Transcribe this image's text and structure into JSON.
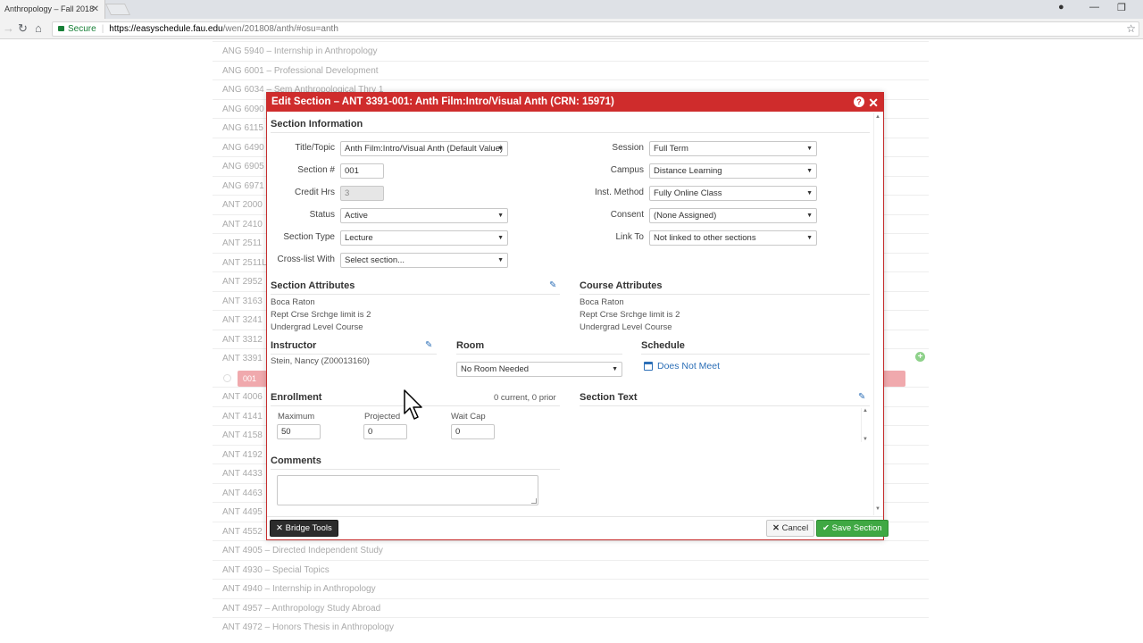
{
  "browser": {
    "tab_title": "Anthropology – Fall 2018",
    "secure_label": "Secure",
    "url_host": "https://easyschedule.fau.edu",
    "url_path": "/wen/201808/anth/#osu=anth"
  },
  "courses": [
    "ANG 5940 – Internship in Anthropology",
    "ANG 6001 – Professional Development",
    "ANG 6034 – Sem Anthropological Thry 1",
    "ANG 6090",
    "ANG 6115",
    "ANG 6490",
    "ANG 6905",
    "ANG 6971",
    "ANT 2000",
    "ANT 2410",
    "ANT 2511",
    "ANT 2511L",
    "ANT 2952",
    "ANT 3163",
    "ANT 3241",
    "ANT 3312",
    "ANT 3391",
    "",
    "ANT 4006",
    "ANT 4141",
    "ANT 4158",
    "ANT 4192",
    "ANT 4433",
    "ANT 4463",
    "ANT 4495",
    "ANT 4552",
    "ANT 4905 – Directed Independent Study",
    "ANT 4930 – Special Topics",
    "ANT 4940 – Internship in Anthropology",
    "ANT 4957 – Anthropology Study Abroad",
    "ANT 4972 – Honors Thesis in Anthropology"
  ],
  "section_chip": "001",
  "modal": {
    "title": "Edit Section – ANT 3391-001: Anth Film:Intro/Visual Anth (CRN: 15971)",
    "section_information": "Section Information",
    "fields_left": [
      {
        "label": "Title/Topic",
        "value": "Anth Film:Intro/Visual Anth (Default Value)",
        "kind": "select"
      },
      {
        "label": "Section #",
        "value": "001",
        "kind": "input"
      },
      {
        "label": "Credit Hrs",
        "value": "3",
        "kind": "input-disabled"
      },
      {
        "label": "Status",
        "value": "Active",
        "kind": "select"
      },
      {
        "label": "Section Type",
        "value": "Lecture",
        "kind": "select"
      },
      {
        "label": "Cross-list With",
        "value": "Select section...",
        "kind": "select"
      }
    ],
    "fields_right": [
      {
        "label": "Session",
        "value": "Full Term"
      },
      {
        "label": "Campus",
        "value": "Distance Learning"
      },
      {
        "label": "Inst. Method",
        "value": "Fully Online Class"
      },
      {
        "label": "Consent",
        "value": "(None Assigned)"
      },
      {
        "label": "Link To",
        "value": "Not linked to other sections"
      }
    ],
    "section_attributes": {
      "title": "Section Attributes",
      "items": [
        "Boca Raton",
        "Rept Crse Srchge limit is 2",
        "Undergrad Level Course"
      ]
    },
    "course_attributes": {
      "title": "Course Attributes",
      "items": [
        "Boca Raton",
        "Rept Crse Srchge limit is 2",
        "Undergrad Level Course"
      ]
    },
    "instructor": {
      "title": "Instructor",
      "value": "Stein, Nancy (Z00013160)"
    },
    "room": {
      "title": "Room",
      "value": "No Room Needed"
    },
    "schedule": {
      "title": "Schedule",
      "value": "Does Not Meet"
    },
    "enrollment": {
      "title": "Enrollment",
      "summary": "0 current, 0 prior",
      "maximum_label": "Maximum",
      "maximum": "50",
      "projected_label": "Projected",
      "projected": "0",
      "waitcap_label": "Wait Cap",
      "waitcap": "0"
    },
    "section_text": {
      "title": "Section Text"
    },
    "comments": {
      "title": "Comments"
    },
    "buttons": {
      "bridge_tools": "Bridge Tools",
      "cancel": "Cancel",
      "save": "Save Section"
    }
  },
  "colors": {
    "modal_header": "#cf2c2c",
    "link": "#2c6fb7",
    "save": "#3fa843"
  }
}
